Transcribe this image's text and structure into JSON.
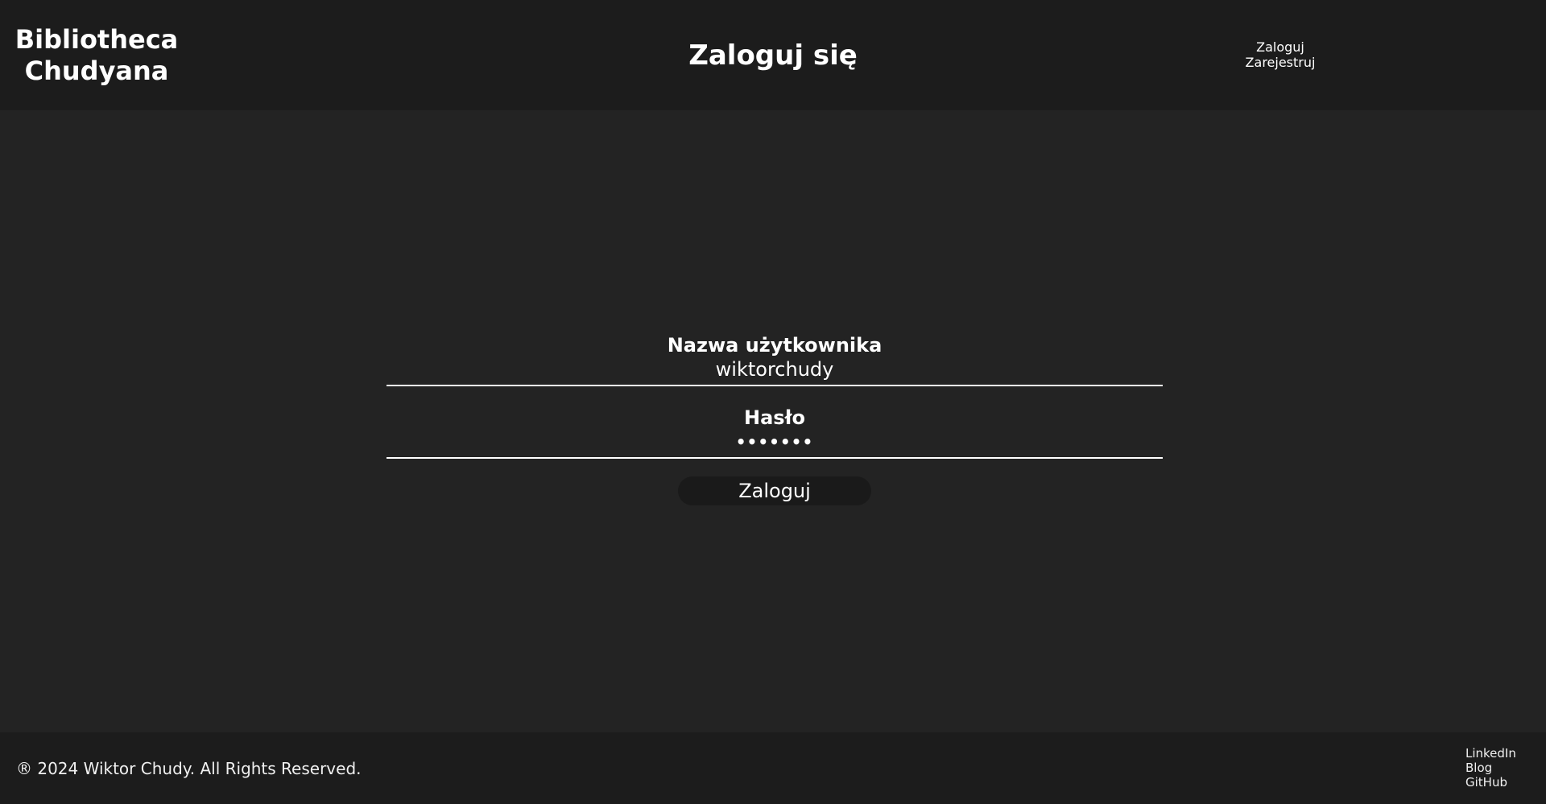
{
  "header": {
    "brand": "Bibliotheca\nChudyana",
    "title": "Zaloguj się",
    "nav": {
      "login": "Zaloguj",
      "register": "Zarejestruj"
    }
  },
  "form": {
    "username_label": "Nazwa użytkownika",
    "username_value": "wiktorchudy",
    "password_label": "Hasło",
    "password_value": "•••••••",
    "submit_label": "Zaloguj"
  },
  "footer": {
    "copyright": "® 2024 Wiktor Chudy. All Rights Reserved.",
    "links": {
      "linkedin": "LinkedIn",
      "blog": "Blog",
      "github": "GitHub"
    }
  },
  "colors": {
    "background": "#232323",
    "header_footer": "#1c1c1c",
    "text": "#ffffff",
    "button": "#1a1a1a"
  }
}
